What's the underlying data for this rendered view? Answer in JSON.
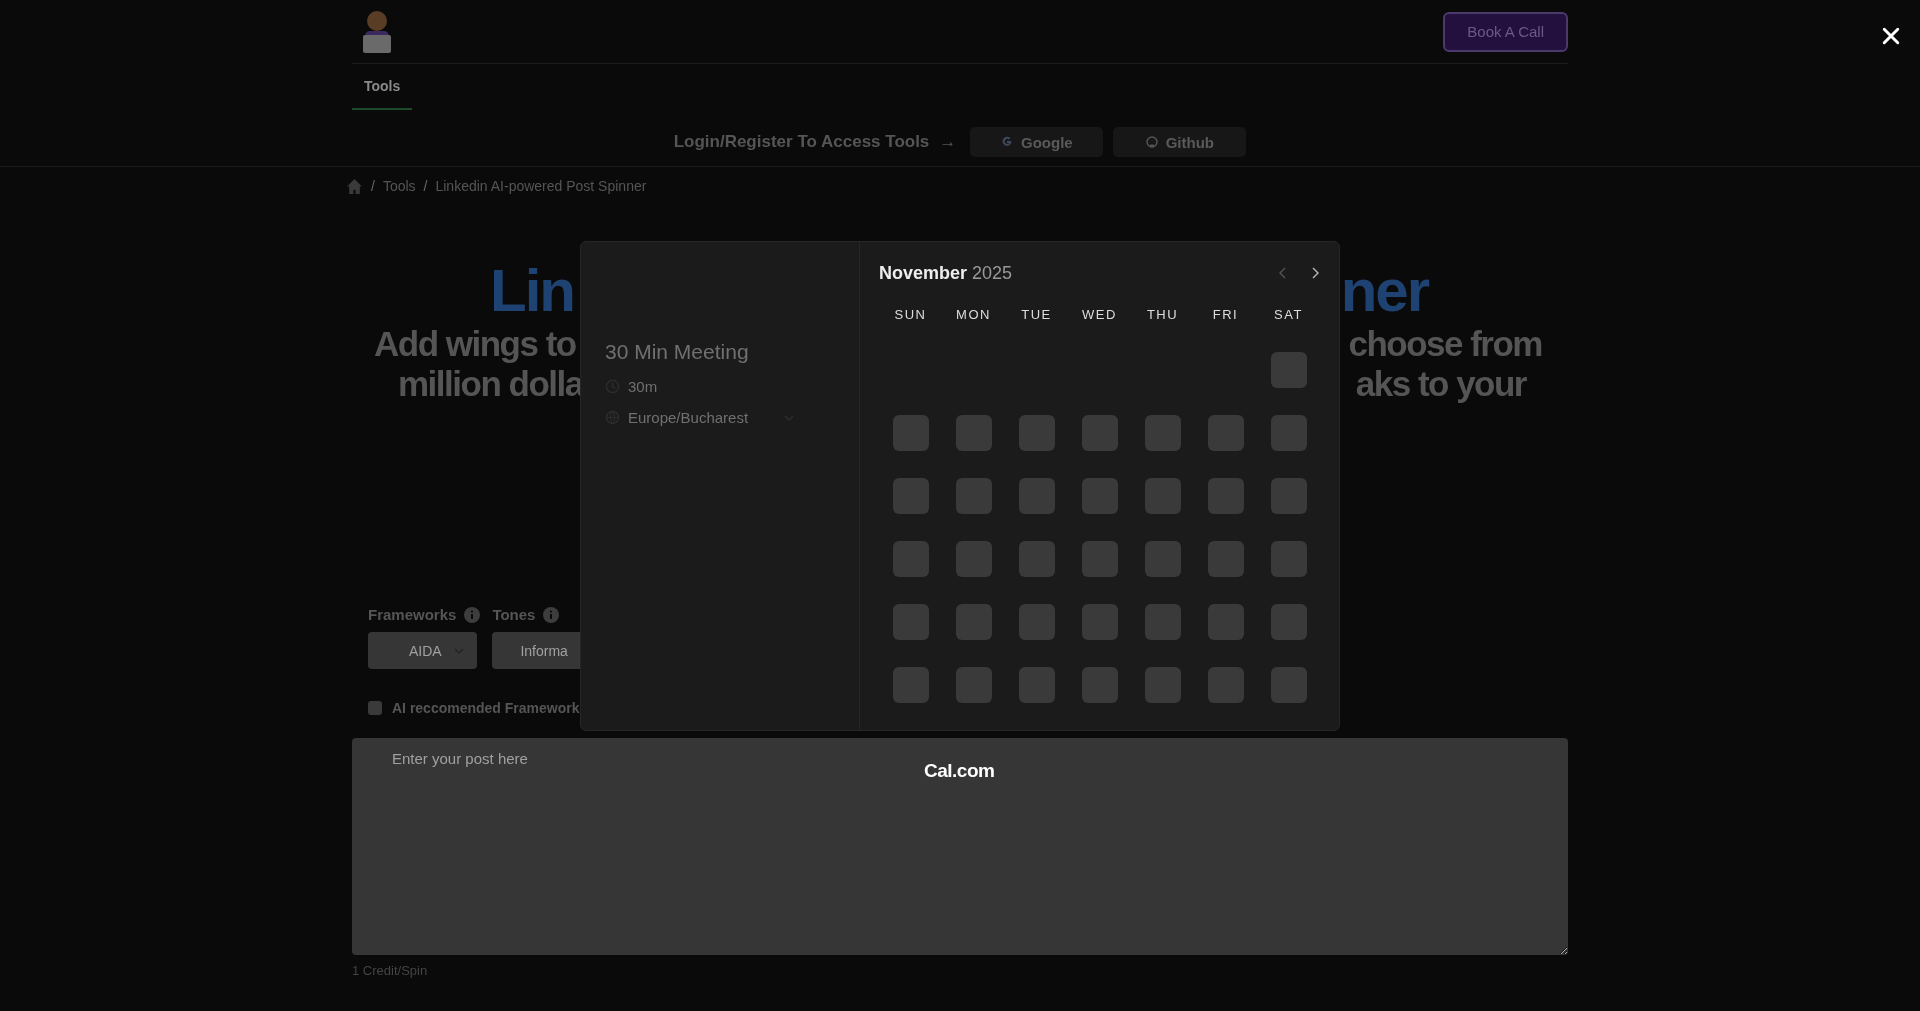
{
  "header": {
    "book_button": "Book A Call"
  },
  "nav": {
    "tabs": [
      {
        "label": "Tools",
        "selected": true
      }
    ]
  },
  "login": {
    "prompt": "Login/Register To Access Tools",
    "arrow": "→",
    "buttons": [
      {
        "label": "Google",
        "kind": "google"
      },
      {
        "label": "Github",
        "kind": "github"
      }
    ]
  },
  "breadcrumb": [
    {
      "separator": "/",
      "label": "Tools"
    },
    {
      "separator": "/",
      "label": "Linkedin AI-powered Post Spinner"
    }
  ],
  "hero": {
    "title_parts": [
      "Lin",
      "ner"
    ],
    "subtitle_lines": [
      [
        "Add wings to",
        "choose from"
      ],
      [
        "million dolla",
        "aks to your"
      ]
    ]
  },
  "form": {
    "fields": [
      {
        "label": "Frameworks",
        "value": "AIDA"
      },
      {
        "label": "Tones",
        "value": "Informa"
      }
    ],
    "checkbox": {
      "label": "AI reccomended Framework",
      "checked": false
    },
    "post": {
      "placeholder": "Enter your post here"
    },
    "cost": "1 Credit/Spin"
  },
  "booking": {
    "event": {
      "title": "30 Min Meeting",
      "duration": "30m",
      "timezone": "Europe/Bucharest"
    },
    "calendar": {
      "month": "November",
      "year": "2025",
      "weekdays": [
        "SUN",
        "MON",
        "TUE",
        "WED",
        "THU",
        "FRI",
        "SAT"
      ],
      "weeks": [
        {
          "slots": [
            false,
            false,
            false,
            false,
            false,
            false,
            true
          ]
        },
        {
          "slots": [
            true,
            true,
            true,
            true,
            true,
            true,
            true
          ]
        },
        {
          "slots": [
            true,
            true,
            true,
            true,
            true,
            true,
            true
          ]
        },
        {
          "slots": [
            true,
            true,
            true,
            true,
            true,
            true,
            true
          ]
        },
        {
          "slots": [
            true,
            true,
            true,
            true,
            true,
            true,
            true
          ]
        },
        {
          "slots": [
            true,
            true,
            true,
            true,
            true,
            true,
            true
          ]
        }
      ]
    },
    "branding": "Cal.com"
  }
}
